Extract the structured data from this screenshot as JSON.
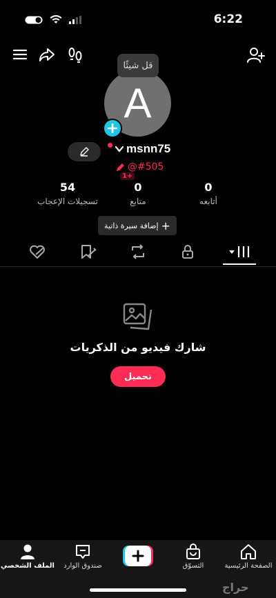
{
  "status": {
    "time": "6:22"
  },
  "header": {
    "bubble_text": "قل شيئًا"
  },
  "profile": {
    "avatar_letter": "A",
    "username": "msnn75",
    "handle": "@#505",
    "level_badge": "1+"
  },
  "stats": [
    {
      "value": "0",
      "label": "أتابعه"
    },
    {
      "value": "0",
      "label": "متابع"
    },
    {
      "value": "54",
      "label": "تسجيلات الإعجاب"
    }
  ],
  "bio_button": {
    "plus": "+",
    "label": "إضافة سيرة ذاتية"
  },
  "tabs": [
    {
      "icon": "grid-icon",
      "active": true
    },
    {
      "icon": "lock-icon"
    },
    {
      "icon": "repost-icon"
    },
    {
      "icon": "favorites-icon"
    },
    {
      "icon": "liked-icon"
    }
  ],
  "empty_state": {
    "icon": "photos-icon",
    "title": "شارك فيديو من الذكريات",
    "button": "تحميل"
  },
  "bottom_nav": [
    {
      "label": "الصفحة الرئيسية",
      "icon": "home-icon"
    },
    {
      "label": "التسوّق",
      "icon": "shop-icon"
    },
    {
      "label": "",
      "icon": "create-icon"
    },
    {
      "label": "صندوق الوارد",
      "icon": "inbox-icon"
    },
    {
      "label": "الملف الشخصي",
      "icon": "profile-icon"
    }
  ],
  "watermark": "حراج",
  "colors": {
    "accent": "#fe2c55",
    "cyan": "#20c6e8",
    "background": "#000000"
  }
}
